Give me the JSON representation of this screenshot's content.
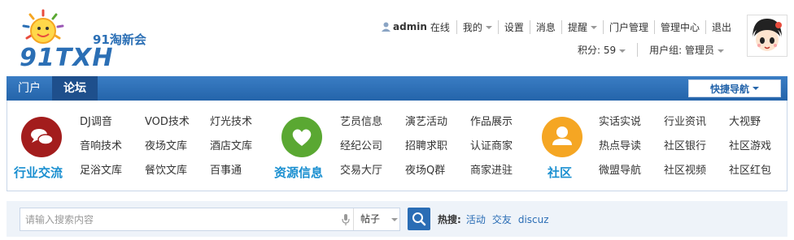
{
  "logo": {
    "text_cn": "91淘新会",
    "text_en": "91TXH"
  },
  "user_nav": {
    "username": "admin",
    "status": "在线",
    "items": [
      "我的",
      "设置",
      "消息",
      "提醒",
      "门户管理",
      "管理中心",
      "退出"
    ]
  },
  "user_info": {
    "points": "积分: 59",
    "group": "用户组: 管理员"
  },
  "nav": {
    "tabs": [
      "门户",
      "论坛"
    ],
    "quick_nav": "快捷导航"
  },
  "groups": [
    {
      "title": "行业交流",
      "color": "#a31d1d",
      "icon": "chat-bubble-icon",
      "links": [
        "DJ调音",
        "VOD技术",
        "灯光技术",
        "音响技术",
        "夜场文库",
        "酒店文库",
        "足浴文库",
        "餐饮文库",
        "百事通"
      ]
    },
    {
      "title": "资源信息",
      "color": "#5aa832",
      "icon": "heart-icon",
      "links": [
        "艺员信息",
        "演艺活动",
        "作品展示",
        "经纪公司",
        "招聘求职",
        "认证商家",
        "交易大厅",
        "夜场Q群",
        "商家进驻"
      ]
    },
    {
      "title": "社区",
      "color": "#f5a623",
      "icon": "user-icon",
      "links": [
        "实话实说",
        "行业资讯",
        "大视野",
        "热点导读",
        "社区银行",
        "社区游戏",
        "微盟导航",
        "社区视频",
        "社区红包"
      ]
    }
  ],
  "search": {
    "placeholder": "请输入搜索内容",
    "type": "帖子",
    "hot_label": "热搜:",
    "hot_terms": [
      "活动",
      "交友",
      "discuz"
    ]
  }
}
